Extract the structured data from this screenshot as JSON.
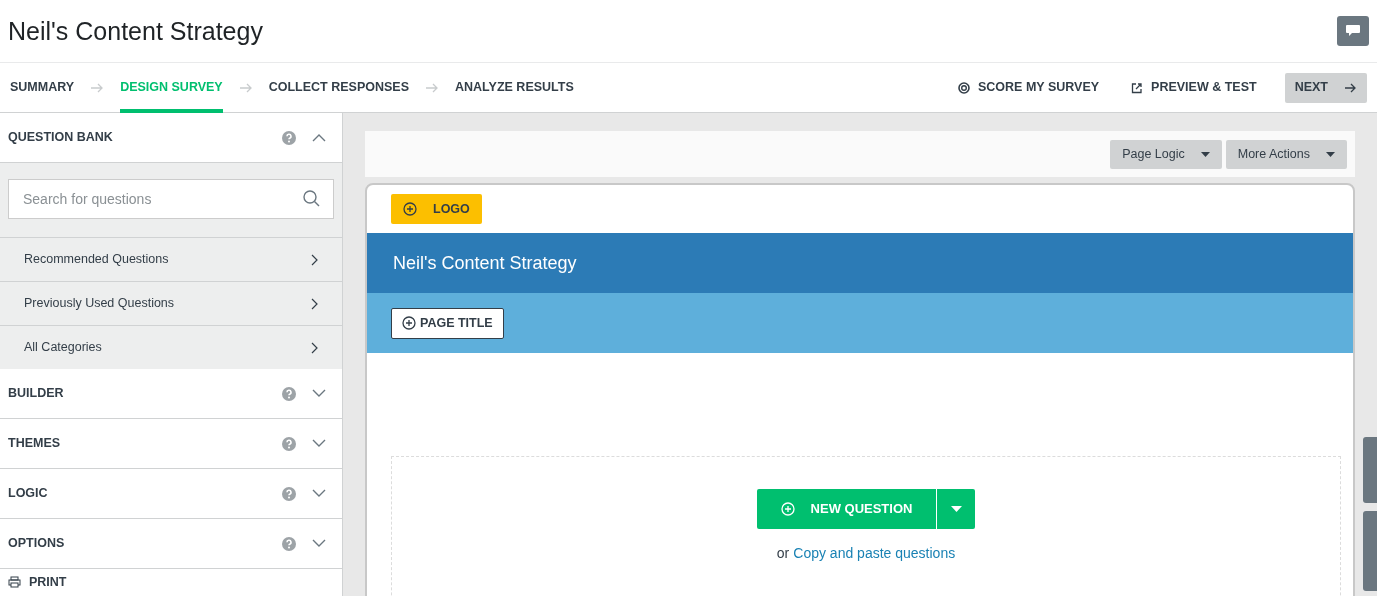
{
  "header": {
    "title": "Neil's Content Strategy"
  },
  "steps": [
    {
      "label": "SUMMARY",
      "selected": false
    },
    {
      "label": "DESIGN SURVEY",
      "selected": true
    },
    {
      "label": "COLLECT RESPONSES",
      "selected": false
    },
    {
      "label": "ANALYZE RESULTS",
      "selected": false
    }
  ],
  "actions": [
    {
      "label": "SCORE MY SURVEY",
      "kind": "score"
    },
    {
      "label": "PREVIEW & TEST",
      "kind": "preview"
    }
  ],
  "next_button": "NEXT",
  "sidebar": {
    "sections": [
      {
        "title": "QUESTION BANK",
        "expanded": true
      },
      {
        "title": "BUILDER",
        "expanded": false
      },
      {
        "title": "THEMES",
        "expanded": false
      },
      {
        "title": "LOGIC",
        "expanded": false
      },
      {
        "title": "OPTIONS",
        "expanded": false
      }
    ],
    "search": {
      "placeholder": "Search for questions"
    },
    "question_bank_items": [
      "Recommended Questions",
      "Previously Used Questions",
      "All Categories"
    ],
    "print": "PRINT"
  },
  "toolbar": [
    "Page Logic",
    "More Actions"
  ],
  "survey": {
    "logo_button": "LOGO",
    "title": "Neil's Content Strategy",
    "page_title_button": "PAGE TITLE",
    "new_question_button": "NEW QUESTION",
    "copy_prefix": "or",
    "copy_link": "Copy and paste questions"
  }
}
